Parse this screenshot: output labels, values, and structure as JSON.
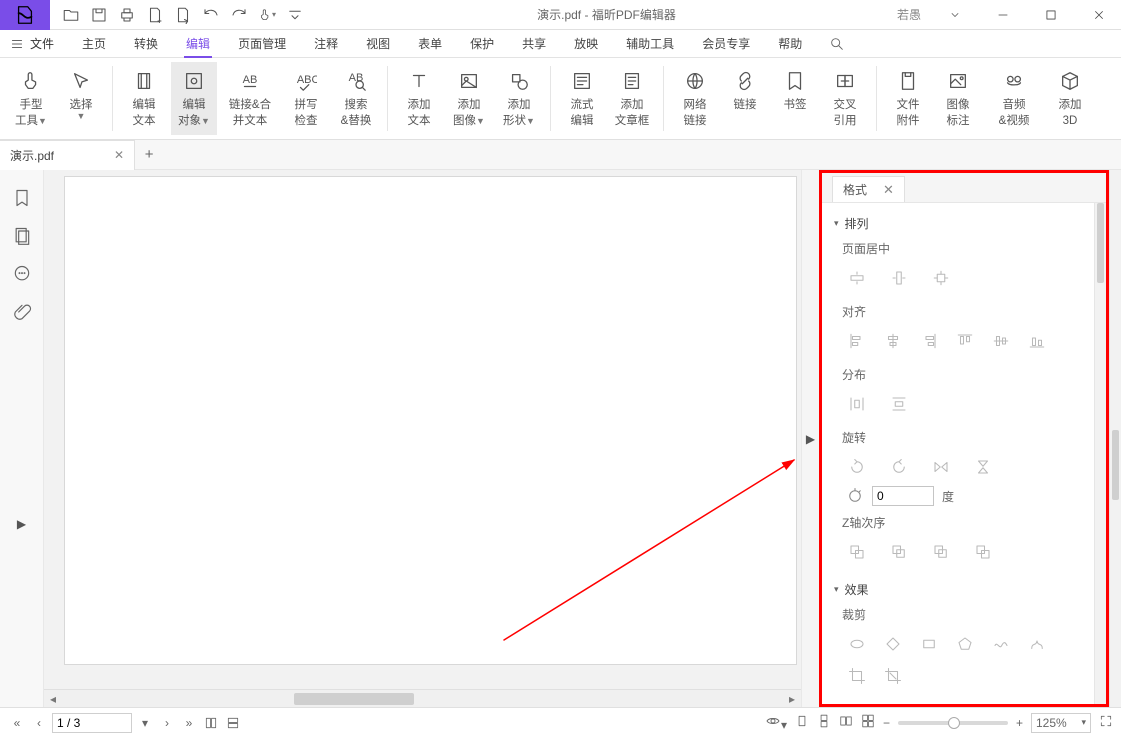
{
  "title": {
    "doc": "演示.pdf",
    "sep": " - ",
    "app": "福昕PDF编辑器"
  },
  "username": "若愚",
  "menu": {
    "fileLabel": "文件",
    "tabs": [
      "主页",
      "转换",
      "编辑",
      "页面管理",
      "注释",
      "视图",
      "表单",
      "保护",
      "共享",
      "放映",
      "辅助工具",
      "会员专享",
      "帮助"
    ],
    "activeTab": "编辑"
  },
  "ribbon": [
    {
      "id": "hand",
      "l1": "手型",
      "l2": "工具",
      "drop": true
    },
    {
      "id": "select",
      "l1": "选择",
      "l2": "",
      "drop": true
    },
    {
      "sep": true
    },
    {
      "id": "edit-text",
      "l1": "编辑",
      "l2": "文本"
    },
    {
      "id": "edit-object",
      "l1": "编辑",
      "l2": "对象",
      "drop": true,
      "active": true
    },
    {
      "id": "link-merge",
      "l1": "链接&合",
      "l2": "并文本",
      "wider": true
    },
    {
      "id": "spellcheck",
      "l1": "拼写",
      "l2": "检查"
    },
    {
      "id": "find-replace",
      "l1": "搜索",
      "l2": "&替换"
    },
    {
      "sep": true
    },
    {
      "id": "add-text",
      "l1": "添加",
      "l2": "文本"
    },
    {
      "id": "add-image",
      "l1": "添加",
      "l2": "图像",
      "drop": true
    },
    {
      "id": "add-shape",
      "l1": "添加",
      "l2": "形状",
      "drop": true
    },
    {
      "sep": true
    },
    {
      "id": "flow-edit",
      "l1": "流式",
      "l2": "编辑"
    },
    {
      "id": "add-article",
      "l1": "添加",
      "l2": "文章框"
    },
    {
      "sep": true
    },
    {
      "id": "web-link",
      "l1": "网络",
      "l2": "链接"
    },
    {
      "id": "link",
      "l1": "链接",
      "l2": ""
    },
    {
      "id": "bookmark",
      "l1": "书签",
      "l2": ""
    },
    {
      "id": "crossref",
      "l1": "交叉",
      "l2": "引用"
    },
    {
      "sep": true
    },
    {
      "id": "attachment",
      "l1": "文件",
      "l2": "附件"
    },
    {
      "id": "image-annot",
      "l1": "图像",
      "l2": "标注"
    },
    {
      "id": "audio-video",
      "l1": "音频",
      "l2": "&视频",
      "wider": true
    },
    {
      "id": "add-3d",
      "l1": "添加",
      "l2": "3D"
    }
  ],
  "doctab": {
    "name": "演示.pdf"
  },
  "format": {
    "tabLabel": "格式",
    "section_arrange": "排列",
    "sub_pagecenter": "页面居中",
    "sub_align": "对齐",
    "sub_distribute": "分布",
    "sub_rotate": "旋转",
    "rotate_value": "0",
    "deg_label": "度",
    "sub_zorder": "Z轴次序",
    "section_effect": "效果",
    "sub_crop": "裁剪"
  },
  "status": {
    "page": "1 / 3",
    "zoom": "125%"
  }
}
